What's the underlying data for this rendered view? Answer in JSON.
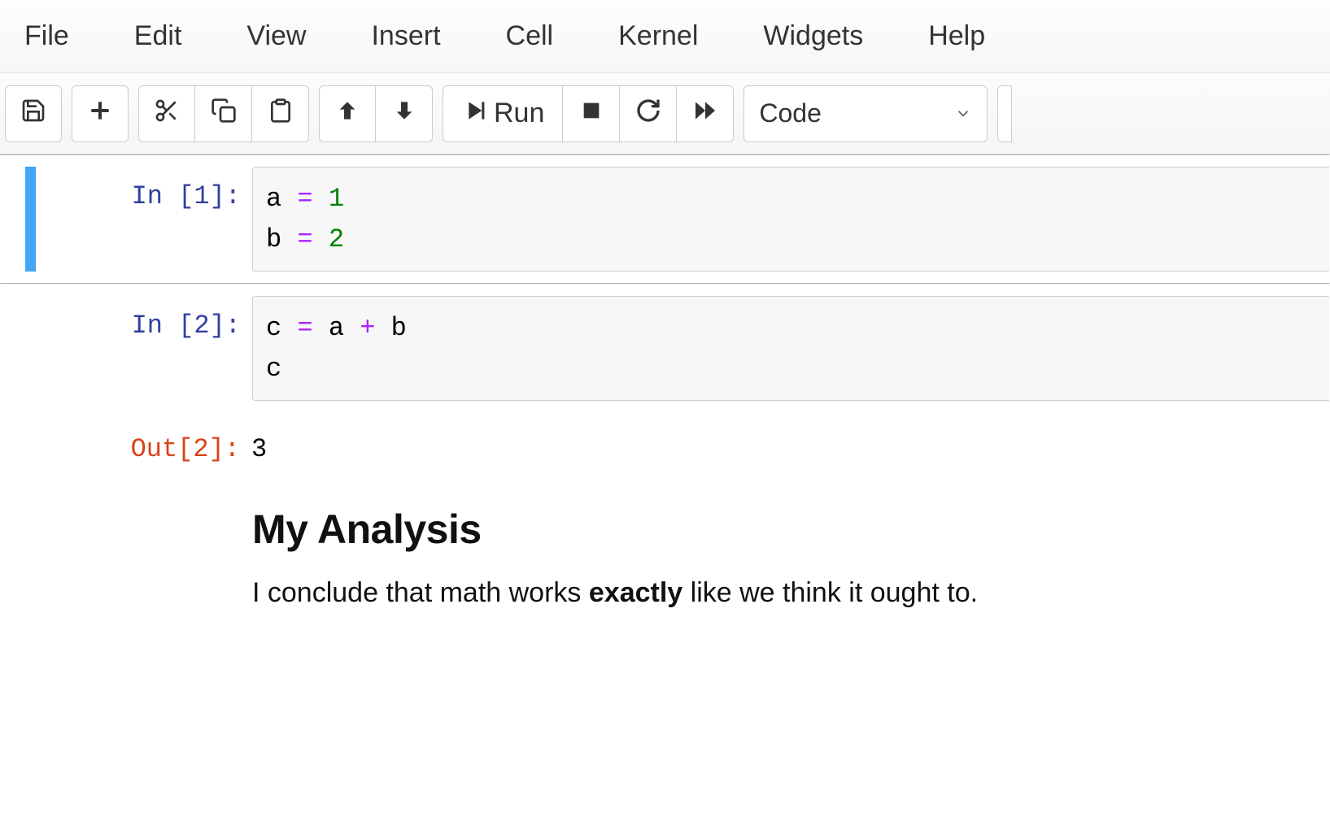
{
  "menu": {
    "file": "File",
    "edit": "Edit",
    "view": "View",
    "insert": "Insert",
    "cell": "Cell",
    "kernel": "Kernel",
    "widgets": "Widgets",
    "help": "Help"
  },
  "toolbar": {
    "run_label": "Run",
    "celltype_selected": "Code",
    "icons": {
      "save": "save-icon",
      "add": "add-icon",
      "cut": "cut-icon",
      "copy": "copy-icon",
      "paste": "paste-icon",
      "up": "arrow-up-icon",
      "down": "arrow-down-icon",
      "run": "run-icon",
      "stop": "stop-icon",
      "restart": "restart-icon",
      "restart_run_all": "fast-forward-icon"
    }
  },
  "cells": [
    {
      "type": "code",
      "selected": true,
      "prompt_in": "In [1]:",
      "code_tokens": [
        {
          "t": "a",
          "c": "var"
        },
        {
          "t": " ",
          "c": ""
        },
        {
          "t": "=",
          "c": "op"
        },
        {
          "t": " ",
          "c": ""
        },
        {
          "t": "1",
          "c": "num"
        },
        {
          "t": "\n",
          "c": ""
        },
        {
          "t": "b",
          "c": "var"
        },
        {
          "t": " ",
          "c": ""
        },
        {
          "t": "=",
          "c": "op"
        },
        {
          "t": " ",
          "c": ""
        },
        {
          "t": "2",
          "c": "num"
        }
      ]
    },
    {
      "type": "code",
      "selected": false,
      "prompt_in": "In [2]:",
      "code_tokens": [
        {
          "t": "c",
          "c": "var"
        },
        {
          "t": " ",
          "c": ""
        },
        {
          "t": "=",
          "c": "op"
        },
        {
          "t": " ",
          "c": ""
        },
        {
          "t": "a",
          "c": "var"
        },
        {
          "t": " ",
          "c": ""
        },
        {
          "t": "+",
          "c": "plus"
        },
        {
          "t": " ",
          "c": ""
        },
        {
          "t": "b",
          "c": "var"
        },
        {
          "t": "\n",
          "c": ""
        },
        {
          "t": "c",
          "c": "var"
        }
      ],
      "prompt_out": "Out[2]:",
      "output": "3"
    },
    {
      "type": "markdown",
      "selected": false,
      "heading": "My Analysis",
      "paragraph_pre": "I conclude that math works ",
      "paragraph_bold": "exactly",
      "paragraph_post": " like we think it ought to."
    }
  ]
}
